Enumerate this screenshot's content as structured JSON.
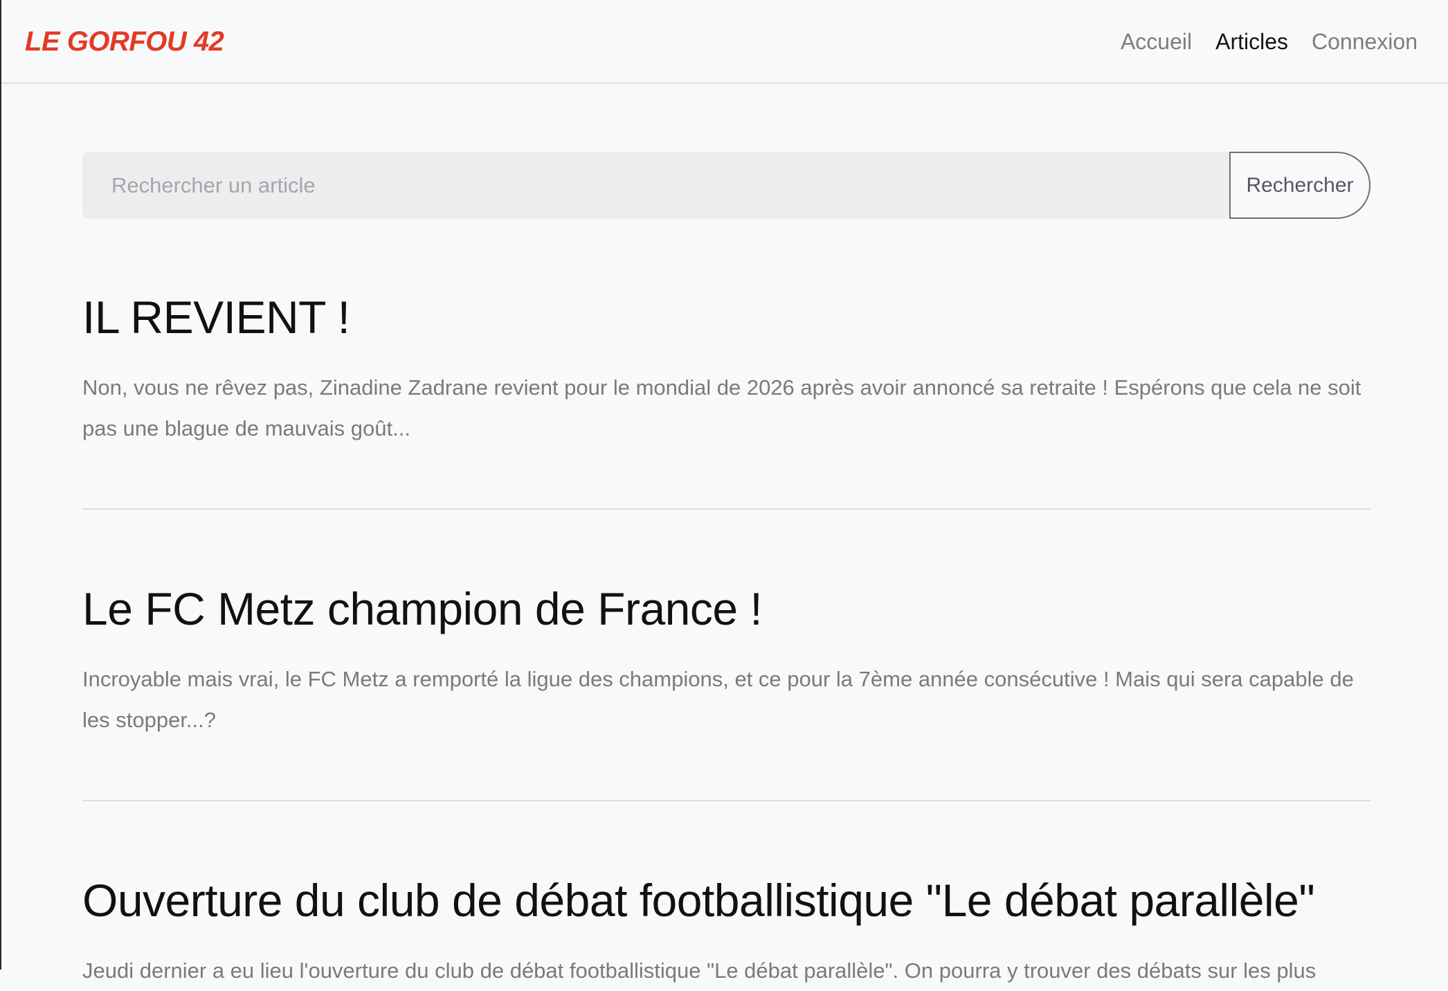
{
  "header": {
    "brand": "LE GORFOU 42",
    "nav": [
      {
        "label": "Accueil"
      },
      {
        "label": "Articles"
      },
      {
        "label": "Connexion"
      }
    ]
  },
  "search": {
    "placeholder": "Rechercher un article",
    "button_label": "Rechercher"
  },
  "articles": [
    {
      "title": "IL REVIENT !",
      "excerpt": "Non, vous ne rêvez pas, Zinadine Zadrane revient pour le mondial de 2026 après avoir annoncé sa retraite ! Espérons que cela ne soit pas une blague de mauvais goût..."
    },
    {
      "title": "Le FC Metz champion de France !",
      "excerpt": "Incroyable mais vrai, le FC Metz a remporté la ligue des champions, et ce pour la 7ème année consécutive ! Mais qui sera capable de les stopper...?"
    },
    {
      "title": "Ouverture du club de débat footballistique \"Le débat parallèle\"",
      "excerpt": "Jeudi dernier a eu lieu l'ouverture du club de débat footballistique \"Le débat parallèle\". On pourra y trouver des débats sur les plus"
    }
  ],
  "colors": {
    "brand": "#e23a25",
    "background": "#f8f9fb",
    "nav_active": "#141414",
    "nav_inactive": "#7d7d7d"
  }
}
